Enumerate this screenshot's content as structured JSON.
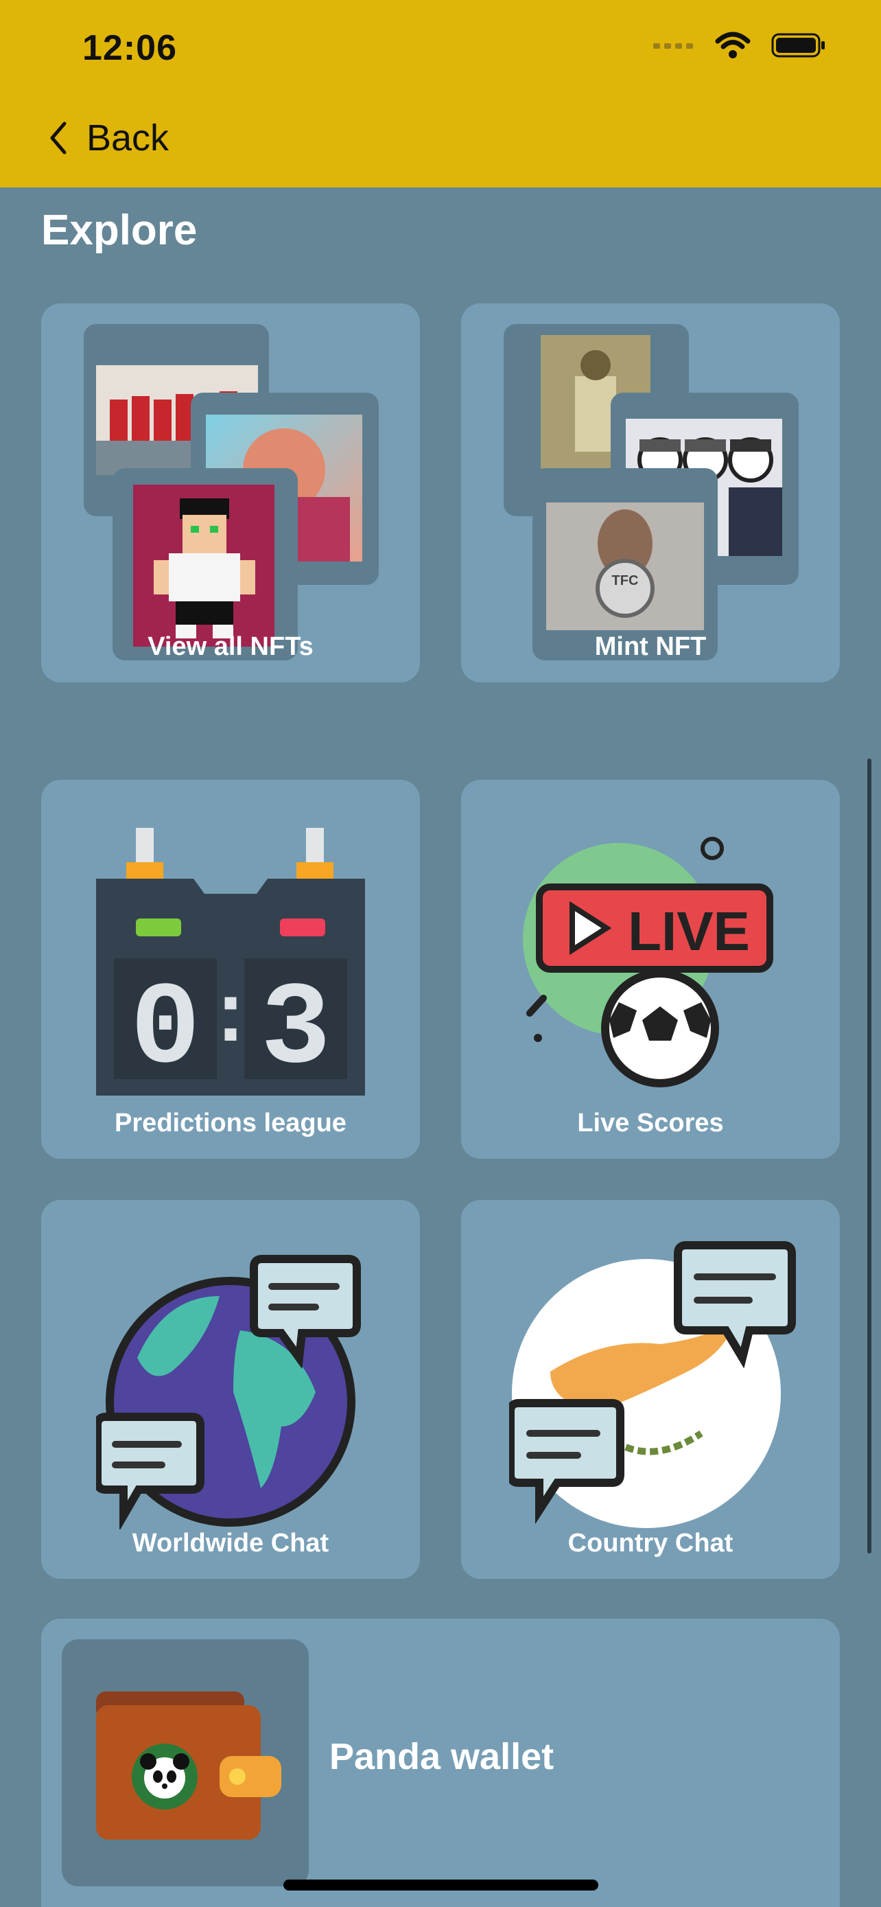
{
  "status_bar": {
    "time": "12:06"
  },
  "nav": {
    "back_label": "Back"
  },
  "page": {
    "title": "Explore"
  },
  "cards": {
    "view_all_nfts": "View all NFTs",
    "mint_nft": "Mint NFT",
    "predictions_league": "Predictions league",
    "live_scores": "Live Scores",
    "worldwide_chat": "Worldwide Chat",
    "country_chat": "Country Chat",
    "panda_wallet": "Panda wallet"
  },
  "scoreboard": {
    "home": "0",
    "separator": ":",
    "away": "3"
  },
  "live_badge": "LIVE",
  "colors": {
    "header": "#dfb507",
    "background": "#658696",
    "card": "#779eb5"
  }
}
